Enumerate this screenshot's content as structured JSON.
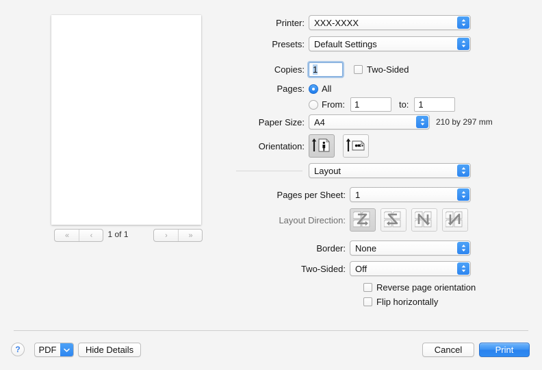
{
  "preview": {
    "page_counter": "1 of 1",
    "nav": {
      "first_label": "«",
      "prev_label": "‹",
      "next_label": "›",
      "last_label": "»"
    }
  },
  "settings": {
    "printer": {
      "label": "Printer:",
      "value": "XXX-XXXX"
    },
    "presets": {
      "label": "Presets:",
      "value": "Default Settings"
    },
    "copies": {
      "label": "Copies:",
      "value": "1"
    },
    "two_sided_checkbox": {
      "label": "Two-Sided",
      "checked": false
    },
    "pages": {
      "label": "Pages:",
      "all_label": "All",
      "all_selected": true,
      "from_label": "From:",
      "from_value": "1",
      "to_label": "to:",
      "to_value": "1",
      "range_selected": false
    },
    "paper_size": {
      "label": "Paper Size:",
      "value": "A4",
      "dimensions": "210 by 297 mm"
    },
    "orientation": {
      "label": "Orientation:",
      "options": [
        "portrait",
        "landscape"
      ],
      "selected": "portrait"
    },
    "pane_popup": {
      "value": "Layout"
    },
    "pages_per_sheet": {
      "label": "Pages per Sheet:",
      "value": "1"
    },
    "layout_direction": {
      "label": "Layout Direction:",
      "options": [
        "across-then-down-z",
        "across-then-down-reverse-z",
        "down-then-across-n",
        "down-then-across-reverse-n"
      ],
      "selected": "across-then-down-z",
      "enabled": false
    },
    "border": {
      "label": "Border:",
      "value": "None"
    },
    "two_sided": {
      "label": "Two-Sided:",
      "value": "Off"
    },
    "reverse_page_orientation": {
      "label": "Reverse page orientation",
      "checked": false
    },
    "flip_horizontally": {
      "label": "Flip horizontally",
      "checked": false
    }
  },
  "footer": {
    "help_label": "?",
    "pdf_label": "PDF",
    "hide_details_label": "Hide Details",
    "cancel_label": "Cancel",
    "print_label": "Print"
  },
  "colors": {
    "accent_blue": "#2e86f0",
    "default_button_blue": "#3d93f4",
    "window_background": "#f4f4f4"
  }
}
